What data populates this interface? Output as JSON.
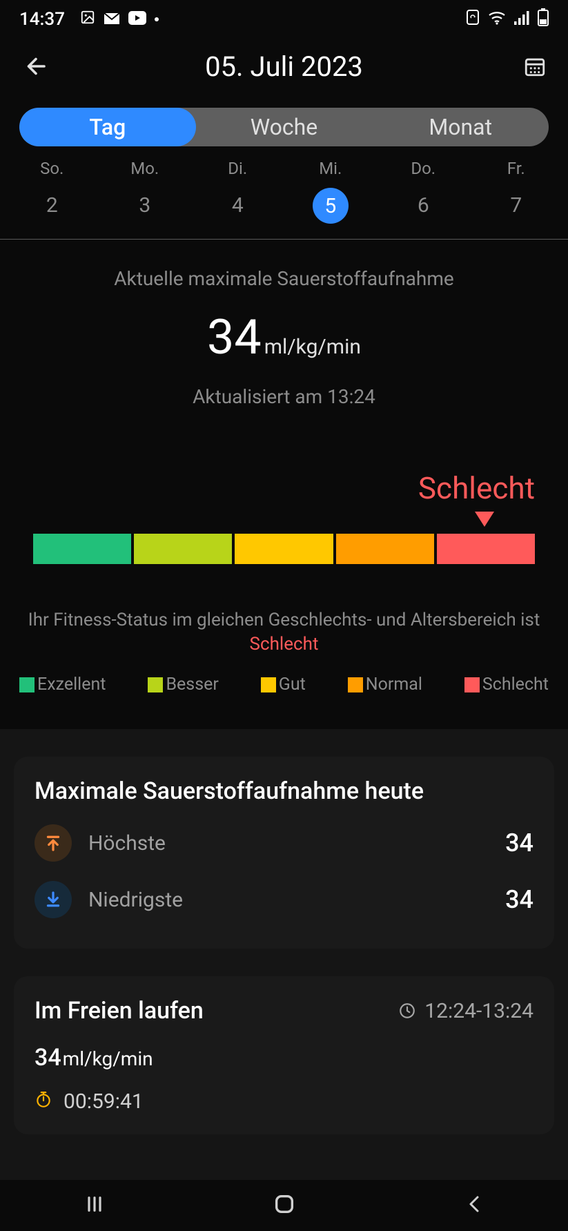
{
  "statusbar": {
    "time": "14:37"
  },
  "topbar": {
    "title": "05. Juli 2023"
  },
  "tabs": {
    "day": "Tag",
    "week": "Woche",
    "month": "Monat"
  },
  "days": [
    {
      "dow": "So.",
      "num": "2",
      "active": false
    },
    {
      "dow": "Mo.",
      "num": "3",
      "active": false
    },
    {
      "dow": "Di.",
      "num": "4",
      "active": false
    },
    {
      "dow": "Mi.",
      "num": "5",
      "active": true
    },
    {
      "dow": "Do.",
      "num": "6",
      "active": false
    },
    {
      "dow": "Fr.",
      "num": "7",
      "active": false
    }
  ],
  "vo2": {
    "label": "Aktuelle maximale Sauerstoffaufnahme",
    "value": "34",
    "unit": "ml/kg/min",
    "updated": "Aktualisiert am 13:24"
  },
  "rating": {
    "label": "Schlecht",
    "marker_index": 4,
    "colors": [
      "#22c07a",
      "#b8d419",
      "#ffc800",
      "#ff9d00",
      "#ff5a5a"
    ]
  },
  "status": {
    "prefix": "Ihr Fitness-Status im gleichen Geschlechts- und Altersbereich ist",
    "value": "Schlecht"
  },
  "legend": [
    {
      "color": "#22c07a",
      "label": "Exzellent"
    },
    {
      "color": "#b8d419",
      "label": "Besser"
    },
    {
      "color": "#ffc800",
      "label": "Gut"
    },
    {
      "color": "#ff9d00",
      "label": "Normal"
    },
    {
      "color": "#ff5a5a",
      "label": "Schlecht"
    }
  ],
  "today_card": {
    "title": "Maximale Sauerstoffaufnahme heute",
    "high_label": "Höchste",
    "high_value": "34",
    "low_label": "Niedrigste",
    "low_value": "34"
  },
  "activity_card": {
    "title": "Im Freien laufen",
    "time_range": "12:24-13:24",
    "metric_value": "34",
    "metric_unit": "ml/kg/min",
    "duration": "00:59:41"
  },
  "chart_data": {
    "type": "bar",
    "title": "VO2max rating scale",
    "categories": [
      "Exzellent",
      "Besser",
      "Gut",
      "Normal",
      "Schlecht"
    ],
    "colors": [
      "#22c07a",
      "#b8d419",
      "#ffc800",
      "#ff9d00",
      "#ff5a5a"
    ],
    "current_value": 34,
    "current_category": "Schlecht",
    "marker_index": 4
  }
}
